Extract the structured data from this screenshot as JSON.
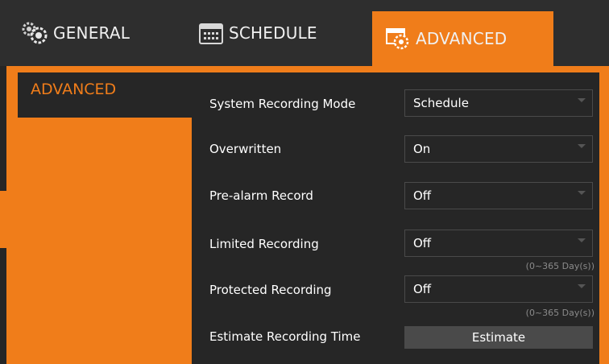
{
  "tabs": [
    {
      "label": "GENERAL",
      "icon": "gears-icon"
    },
    {
      "label": "SCHEDULE",
      "icon": "calendar-icon"
    },
    {
      "label": "ADVANCED",
      "icon": "advanced-settings-icon"
    }
  ],
  "sidebar": {
    "active_label": "ADVANCED"
  },
  "settings": {
    "system_recording_mode": {
      "label": "System Recording Mode",
      "value": "Schedule"
    },
    "overwritten": {
      "label": "Overwritten",
      "value": "On"
    },
    "pre_alarm_record": {
      "label": "Pre-alarm Record",
      "value": "Off"
    },
    "limited_recording": {
      "label": "Limited Recording",
      "value": "Off",
      "hint": "(0~365 Day(s))"
    },
    "protected_recording": {
      "label": "Protected Recording",
      "value": "Off",
      "hint": "(0~365 Day(s))"
    },
    "estimate_recording_time": {
      "label": "Estimate Recording Time",
      "button": "Estimate"
    }
  },
  "colors": {
    "accent": "#f07d1a",
    "background": "#262626"
  }
}
